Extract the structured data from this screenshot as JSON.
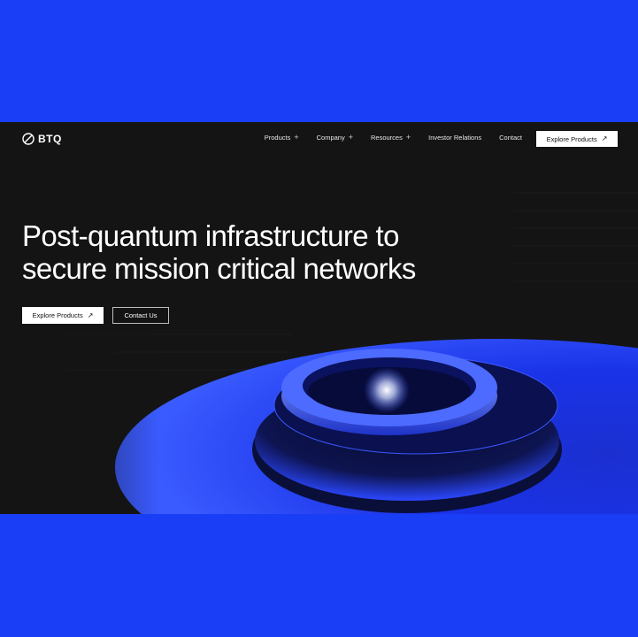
{
  "brand": {
    "name": "BTQ",
    "logo_icon": "btq-logo-icon"
  },
  "nav": {
    "items": [
      {
        "label": "Products",
        "icon": "plus-icon",
        "expandable": true
      },
      {
        "label": "Company",
        "icon": "plus-icon",
        "expandable": true
      },
      {
        "label": "Resources",
        "icon": "plus-icon",
        "expandable": true
      },
      {
        "label": "Investor Relations",
        "expandable": false
      },
      {
        "label": "Contact",
        "expandable": false
      }
    ],
    "cta_label": "Explore Products",
    "cta_icon": "arrow-up-right-icon"
  },
  "hero": {
    "headline_line1": "Post-quantum infrastructure to",
    "headline_line2": "secure mission critical networks",
    "primary_label": "Explore Products",
    "primary_icon": "arrow-up-right-icon",
    "secondary_label": "Contact Us"
  },
  "colors": {
    "outer_background": "#1a3ef5",
    "page_background": "#141414",
    "accent_blue": "#2a44ff",
    "text": "#ffffff"
  }
}
